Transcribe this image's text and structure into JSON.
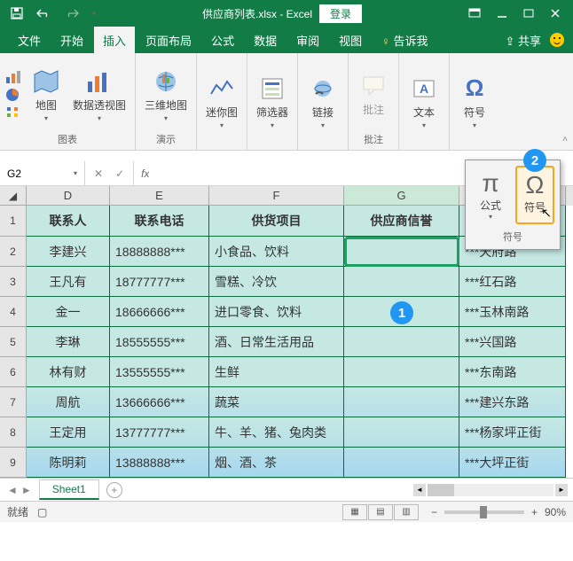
{
  "titlebar": {
    "filename": "供应商列表.xlsx - Excel",
    "login": "登录"
  },
  "tabs": {
    "file": "文件",
    "home": "开始",
    "insert": "插入",
    "layout": "页面布局",
    "formula": "公式",
    "data": "数据",
    "review": "审阅",
    "view": "视图",
    "tell": "告诉我",
    "share": "共享"
  },
  "ribbon": {
    "map": "地图",
    "pivot": "数据透视图",
    "map3d": "三维地图",
    "spark": "迷你图",
    "filter": "筛选器",
    "link": "链接",
    "comment": "批注",
    "text": "文本",
    "symbol": "符号",
    "g_chart": "图表",
    "g_demo": "演示",
    "g_comment": "批注"
  },
  "popup": {
    "equation": "公式",
    "symbol": "符号",
    "group": "符号"
  },
  "namebox": "G2",
  "columns": {
    "d": "D",
    "e": "E",
    "f": "F",
    "g": "G",
    "h": ""
  },
  "header_row": {
    "d": "联系人",
    "e": "联系电话",
    "f": "供货项目",
    "g": "供应商信誉"
  },
  "rows": [
    {
      "n": "2",
      "d": "李建兴",
      "e": "18888888***",
      "f": "小食品、饮料",
      "g": "",
      "h": "***天府路"
    },
    {
      "n": "3",
      "d": "王凡有",
      "e": "18777777***",
      "f": "雪糕、冷饮",
      "g": "",
      "h": "***红石路"
    },
    {
      "n": "4",
      "d": "金一",
      "e": "18666666***",
      "f": "进口零食、饮料",
      "g": "",
      "h": "***玉林南路"
    },
    {
      "n": "5",
      "d": "李琳",
      "e": "18555555***",
      "f": "酒、日常生活用品",
      "g": "",
      "h": "***兴国路"
    },
    {
      "n": "6",
      "d": "林有财",
      "e": "13555555***",
      "f": "生鲜",
      "g": "",
      "h": "***东南路"
    },
    {
      "n": "7",
      "d": "周航",
      "e": "13666666***",
      "f": "蔬菜",
      "g": "",
      "h": "***建兴东路"
    },
    {
      "n": "8",
      "d": "王定用",
      "e": "13777777***",
      "f": "牛、羊、猪、兔肉类",
      "g": "",
      "h": "***杨家坪正街"
    },
    {
      "n": "9",
      "d": "陈明莉",
      "e": "13888888***",
      "f": "烟、酒、茶",
      "g": "",
      "h": "***大坪正街"
    }
  ],
  "sheet": "Sheet1",
  "status": {
    "ready": "就绪",
    "zoom": "90%"
  },
  "callouts": {
    "c1": "1",
    "c2": "2"
  }
}
